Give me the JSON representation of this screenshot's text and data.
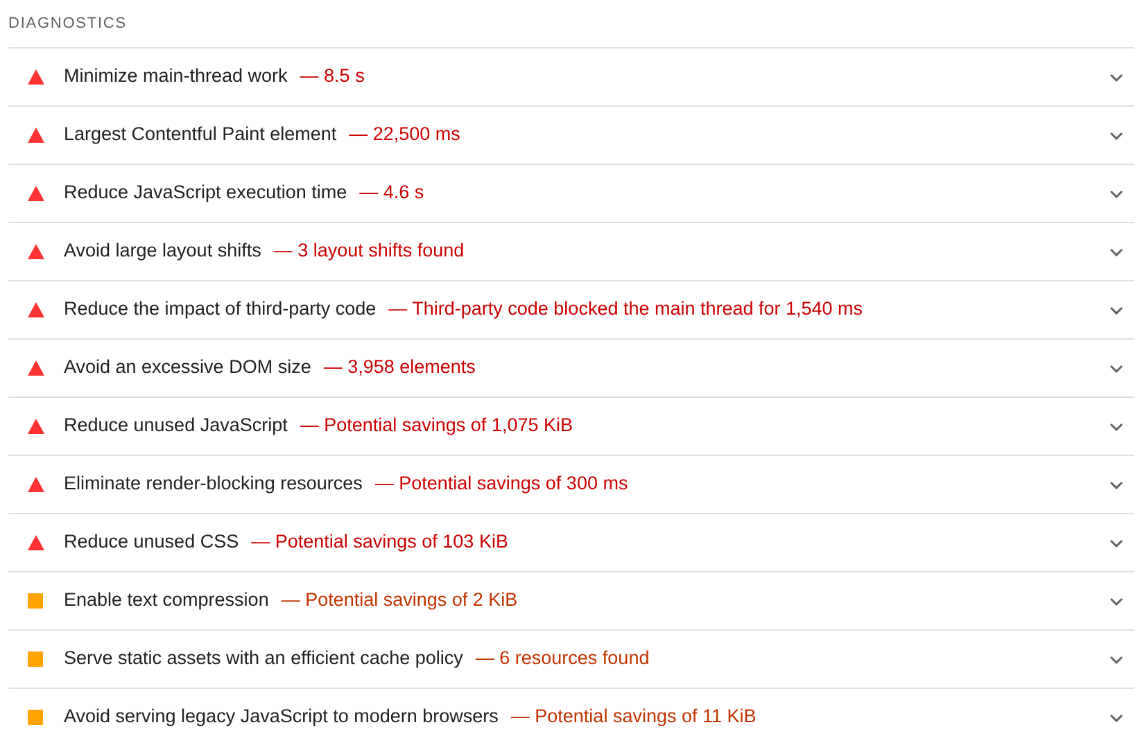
{
  "section_title": "DIAGNOSTICS",
  "audits": [
    {
      "kind": "fail",
      "title": "Minimize main-thread work",
      "detail": "— 8.5 s",
      "expanded": false
    },
    {
      "kind": "fail",
      "title": "Largest Contentful Paint element",
      "detail": "— 22,500 ms",
      "expanded": false
    },
    {
      "kind": "fail",
      "title": "Reduce JavaScript execution time",
      "detail": "— 4.6 s",
      "expanded": false
    },
    {
      "kind": "fail",
      "title": "Avoid large layout shifts",
      "detail": "— 3 layout shifts found",
      "expanded": false
    },
    {
      "kind": "fail",
      "title": "Reduce the impact of third-party code",
      "detail": "— Third-party code blocked the main thread for 1,540 ms",
      "expanded": false
    },
    {
      "kind": "fail",
      "title": "Avoid an excessive DOM size",
      "detail": "— 3,958 elements",
      "expanded": false
    },
    {
      "kind": "fail",
      "title": "Reduce unused JavaScript",
      "detail": "— Potential savings of 1,075 KiB",
      "expanded": false
    },
    {
      "kind": "fail",
      "title": "Eliminate render-blocking resources",
      "detail": "— Potential savings of 300 ms",
      "expanded": false
    },
    {
      "kind": "fail",
      "title": "Reduce unused CSS",
      "detail": "— Potential savings of 103 KiB",
      "expanded": false
    },
    {
      "kind": "average",
      "title": "Enable text compression",
      "detail": "— Potential savings of 2 KiB",
      "expanded": false
    },
    {
      "kind": "average",
      "title": "Serve static assets with an efficient cache policy",
      "detail": "— 6 resources found",
      "expanded": false
    },
    {
      "kind": "average",
      "title": "Avoid serving legacy JavaScript to modern browsers",
      "detail": "— Potential savings of 11 KiB",
      "expanded": false
    }
  ]
}
